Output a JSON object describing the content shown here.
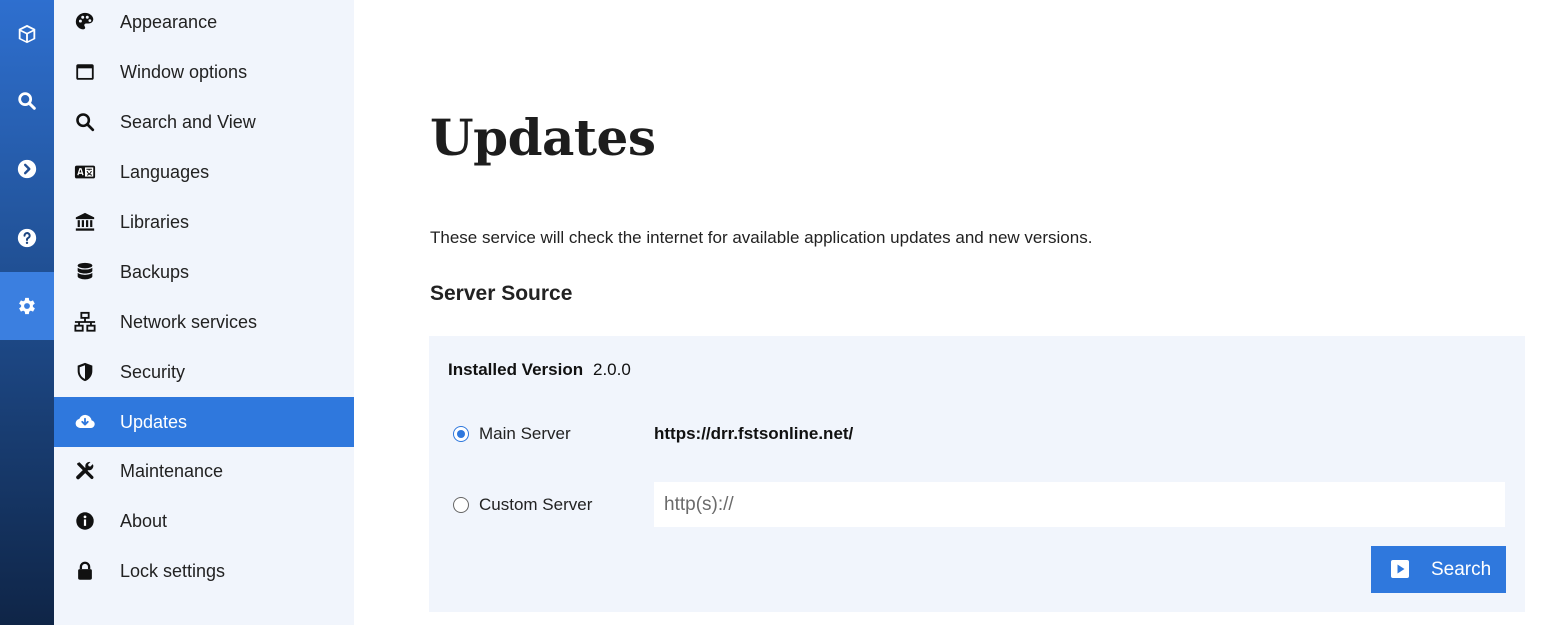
{
  "rail": {
    "items": [
      {
        "icon": "cube-icon"
      },
      {
        "icon": "search-icon"
      },
      {
        "icon": "chevron-right-circle-icon"
      },
      {
        "icon": "help-circle-icon"
      },
      {
        "icon": "gear-icon",
        "active": true
      }
    ]
  },
  "nav": {
    "items": [
      {
        "label": "Appearance",
        "icon": "palette-icon"
      },
      {
        "label": "Window options",
        "icon": "window-icon"
      },
      {
        "label": "Search and View",
        "icon": "search-icon"
      },
      {
        "label": "Languages",
        "icon": "language-icon"
      },
      {
        "label": "Libraries",
        "icon": "library-icon"
      },
      {
        "label": "Backups",
        "icon": "database-icon"
      },
      {
        "label": "Network services",
        "icon": "network-icon"
      },
      {
        "label": "Security",
        "icon": "shield-icon"
      },
      {
        "label": "Updates",
        "icon": "cloud-download-icon",
        "active": true
      },
      {
        "label": "Maintenance",
        "icon": "tools-icon"
      },
      {
        "label": "About",
        "icon": "info-icon"
      },
      {
        "label": "Lock settings",
        "icon": "lock-icon"
      }
    ]
  },
  "main": {
    "title": "Updates",
    "description": "These service will check the internet for available application updates and new versions.",
    "section_title": "Server Source",
    "installed_label": "Installed Version",
    "installed_value": "2.0.0",
    "main_server_label": "Main Server",
    "main_server_url": "https://drr.fstsonline.net/",
    "main_server_selected": true,
    "custom_server_label": "Custom Server",
    "custom_server_placeholder": "http(s)://",
    "custom_server_value": "",
    "search_button_label": "Search"
  },
  "colors": {
    "accent": "#2f78dd",
    "nav_background": "#f1f5fc",
    "panel_background": "#f1f5fc",
    "rail_top": "#2e6fcf",
    "rail_bottom": "#0f2547"
  }
}
